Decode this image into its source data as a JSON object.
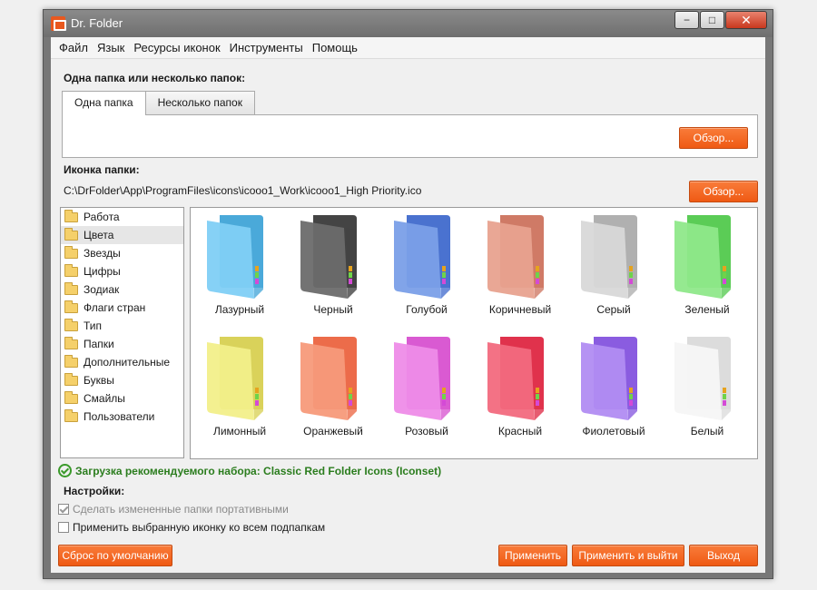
{
  "window": {
    "title": "Dr. Folder",
    "minimize_label": "−",
    "maximize_label": "□",
    "close_label": "✕"
  },
  "menu": [
    "Файл",
    "Язык",
    "Ресурсы иконок",
    "Инструменты",
    "Помощь"
  ],
  "folders_section": {
    "label": "Одна папка или несколько папок:",
    "tabs": [
      "Одна папка",
      "Несколько папок"
    ],
    "browse_label": "Обзор..."
  },
  "icon_section": {
    "label": "Иконка папки:",
    "path": "C:\\DrFolder\\App\\ProgramFiles\\icons\\icooo1_Work\\icooo1_High Priority.ico",
    "browse_label": "Обзор..."
  },
  "categories": [
    "Работа",
    "Цвета",
    "Звезды",
    "Цифры",
    "Зодиак",
    "Флаги стран",
    "Тип",
    "Папки",
    "Дополнительные",
    "Буквы",
    "Смайлы",
    "Пользователи"
  ],
  "selected_category": "Цвета",
  "icons": [
    {
      "label": "Лазурный",
      "color": "#7fcff5",
      "dark": "#4aa9d9"
    },
    {
      "label": "Черный",
      "color": "#6b6b6b",
      "dark": "#444444"
    },
    {
      "label": "Голубой",
      "color": "#7a9fe8",
      "dark": "#4a72cf"
    },
    {
      "label": "Коричневый",
      "color": "#e8a28f",
      "dark": "#cf7a66"
    },
    {
      "label": "Серый",
      "color": "#d8d8d8",
      "dark": "#b0b0b0"
    },
    {
      "label": "Зеленый",
      "color": "#8fe88a",
      "dark": "#5bcc56"
    },
    {
      "label": "Лимонный",
      "color": "#f2ef8a",
      "dark": "#d9d25a"
    },
    {
      "label": "Оранжевый",
      "color": "#f79a7a",
      "dark": "#ec6c4a"
    },
    {
      "label": "Розовый",
      "color": "#ee8ce8",
      "dark": "#d95ad2"
    },
    {
      "label": "Красный",
      "color": "#f26a7e",
      "dark": "#e0324c"
    },
    {
      "label": "Фиолетовый",
      "color": "#b18cf2",
      "dark": "#8a5ce0"
    },
    {
      "label": "Белый",
      "color": "#f6f6f6",
      "dark": "#dcdcdc"
    }
  ],
  "recommend_text": "Загрузка рекомендуемого набора: Classic Red Folder Icons (Iconset)",
  "settings": {
    "label": "Настройки:",
    "portable_label": "Сделать измененные папки портативными",
    "portable_checked": true,
    "apply_sub_label": "Применить выбранную иконку ко всем подпапкам",
    "apply_sub_checked": false
  },
  "buttons": {
    "reset": "Сброс по умолчанию",
    "apply": "Применить",
    "apply_exit": "Применить и выйти",
    "exit": "Выход"
  }
}
